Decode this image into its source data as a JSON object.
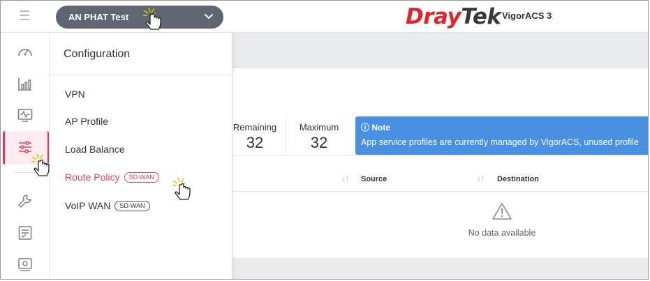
{
  "header": {
    "site_select_label": "AN PHAT Test",
    "brand_dray": "Dray",
    "brand_tek": "Tek",
    "product_name": "VigorACS 3"
  },
  "rail": {
    "icons": [
      "dashboard-icon",
      "bar-chart-icon",
      "monitor-icon",
      "sliders-icon",
      "wrench-icon",
      "checklist-icon",
      "settings-panel-icon"
    ],
    "active_icon": "sliders-icon"
  },
  "menu": {
    "title": "Configuration",
    "items": [
      {
        "label": "VPN",
        "badge": ""
      },
      {
        "label": "AP Profile",
        "badge": ""
      },
      {
        "label": "Load Balance",
        "badge": ""
      },
      {
        "label": "Route Policy",
        "badge": "SD-WAN"
      },
      {
        "label": "VoIP WAN",
        "badge": "SD-WAN"
      }
    ],
    "active_item": "Route Policy"
  },
  "stats": {
    "remaining_label": "Remaining",
    "remaining_value": "32",
    "maximum_label": "Maximum",
    "maximum_value": "32"
  },
  "note": {
    "title": "ⓘ Note",
    "text": "App service profiles are currently managed by VigorACS, unused profile"
  },
  "table": {
    "columns": [
      "Source",
      "Destination"
    ],
    "empty_text": "No data available"
  },
  "colors": {
    "accent": "#e0435b",
    "note_bg": "#4a90e2",
    "select_bg": "#5f6671",
    "brand_red": "#e2232a"
  }
}
